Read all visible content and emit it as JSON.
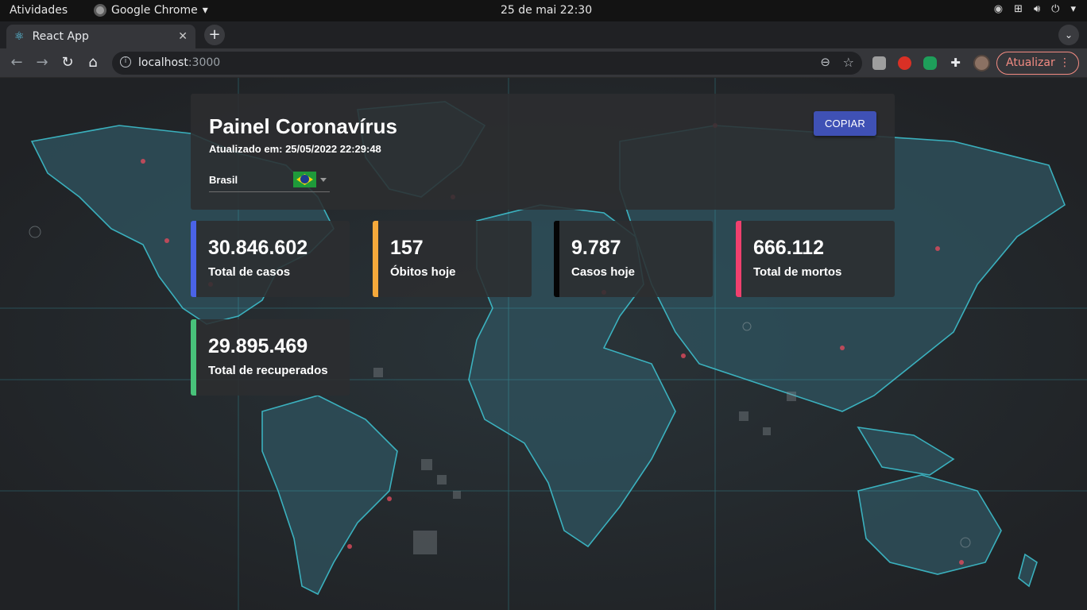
{
  "system_bar": {
    "activities": "Atividades",
    "app_name": "Google Chrome",
    "clock": "25 de mai  22:30"
  },
  "browser": {
    "tab_title": "React App",
    "url_host": "localhost",
    "url_port": ":3000",
    "update_label": "Atualizar"
  },
  "panel": {
    "title": "Painel Coronavírus",
    "updated": "Atualizado em: 25/05/2022 22:29:48",
    "copy_label": "COPIAR",
    "country": "Brasil"
  },
  "stats": [
    {
      "value": "30.846.602",
      "label": "Total de casos",
      "color": "#4a63e7"
    },
    {
      "value": "157",
      "label": "Óbitos hoje",
      "color": "#f5a93b"
    },
    {
      "value": "9.787",
      "label": "Casos hoje",
      "color": "#050505"
    },
    {
      "value": "666.112",
      "label": "Total de mortos",
      "color": "#f0406e"
    },
    {
      "value": "29.895.469",
      "label": "Total de recuperados",
      "color": "#48c27a"
    }
  ]
}
